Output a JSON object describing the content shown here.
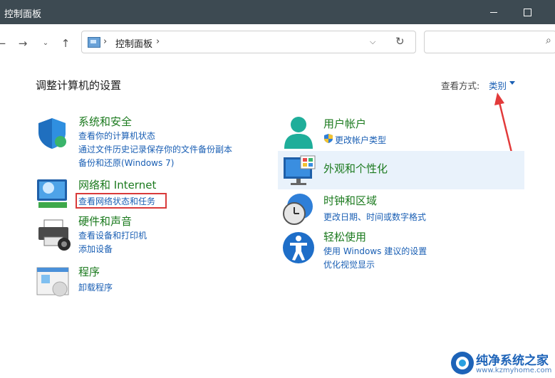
{
  "window": {
    "title": "控制面板"
  },
  "address": {
    "crumb": "控制面板",
    "separator": "›"
  },
  "heading": "调整计算机的设置",
  "view": {
    "label": "查看方式:",
    "value": "类别"
  },
  "categories": {
    "system_security": {
      "title": "系统和安全",
      "links": [
        "查看你的计算机状态",
        "通过文件历史记录保存你的文件备份副本",
        "备份和还原(Windows 7)"
      ]
    },
    "network": {
      "title": "网络和 Internet",
      "links": [
        "查看网络状态和任务"
      ]
    },
    "hardware": {
      "title": "硬件和声音",
      "links": [
        "查看设备和打印机",
        "添加设备"
      ]
    },
    "programs": {
      "title": "程序",
      "links": [
        "卸载程序"
      ]
    },
    "user_accounts": {
      "title": "用户帐户",
      "links": [
        "更改帐户类型"
      ]
    },
    "appearance": {
      "title": "外观和个性化",
      "links": []
    },
    "clock_region": {
      "title": "时钟和区域",
      "links": [
        "更改日期、时间或数字格式"
      ]
    },
    "ease_access": {
      "title": "轻松使用",
      "links": [
        "使用 Windows 建议的设置",
        "优化视觉显示"
      ]
    }
  },
  "watermark": {
    "name": "纯净系统之家",
    "url": "www.kzmyhome.com"
  },
  "colors": {
    "titlebar": "#3d4a52",
    "category_title": "#1b7a1e",
    "link": "#1a5fb4",
    "highlight": "#e9f2fb",
    "annotation": "#d93a3a"
  }
}
